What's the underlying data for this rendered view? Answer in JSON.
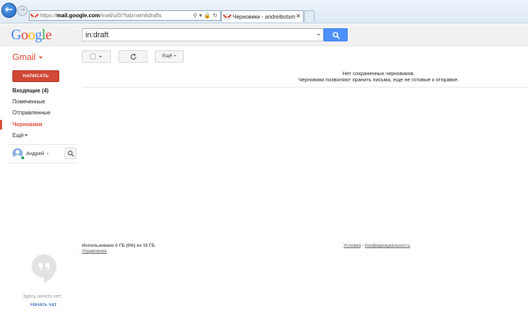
{
  "browser": {
    "url_proto": "https://",
    "url_host": "mail.google.com",
    "url_rest": "/mail/u/0/?tab=wm#drafts",
    "tab_title": "Черновики - andreibotsma..."
  },
  "google_bar": {
    "logo_letters": [
      "G",
      "o",
      "o",
      "g",
      "l",
      "e"
    ],
    "search_value": "in:draft"
  },
  "gmail": {
    "app_label": "Gmail",
    "toolbar": {
      "more_label": "Ещё"
    },
    "compose_label": "НАПИСАТЬ",
    "nav": [
      {
        "label": "Входящие (4)",
        "state": "bold"
      },
      {
        "label": "Помеченные",
        "state": "normal"
      },
      {
        "label": "Отправленные",
        "state": "normal"
      },
      {
        "label": "Черновики",
        "state": "active"
      },
      {
        "label": "Ещё",
        "state": "normal"
      }
    ],
    "user_name": "Андрей",
    "chat": {
      "empty_text": "Здесь ничего нет.",
      "start_chat": "Начать чат"
    },
    "main": {
      "empty_title": "Нет сохраненных черновиков.",
      "empty_desc": "Черновики позволяют хранить письма, еще не готовые к отправке."
    },
    "footer": {
      "usage": "Использовано 0 ГБ (0%) из 15 ГБ",
      "manage": "Управление",
      "terms": "Условия",
      "separator": " - ",
      "privacy": "Конфиденциальность"
    }
  },
  "colors": {
    "brand_red": "#dd4b39",
    "compose_red": "#d14836",
    "search_blue": "#4d90fe",
    "link_blue": "#1a55b4"
  }
}
